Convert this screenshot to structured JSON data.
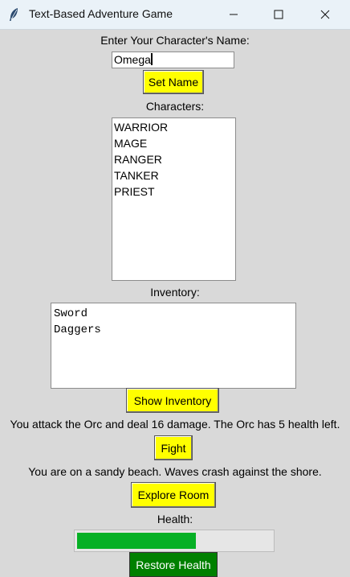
{
  "window": {
    "title": "Text-Based Adventure Game",
    "controls": [
      "minimize-icon",
      "maximize-icon",
      "close-icon"
    ]
  },
  "name_section": {
    "prompt": "Enter Your Character's Name:",
    "value": "Omega",
    "button": "Set Name"
  },
  "characters": {
    "label": "Characters:",
    "items": [
      "WARRIOR",
      "MAGE",
      "RANGER",
      "TANKER",
      "PRIEST"
    ]
  },
  "inventory": {
    "label": "Inventory:",
    "lines": [
      "Sword",
      "Daggers"
    ],
    "button": "Show Inventory"
  },
  "combat": {
    "message": "You attack the Orc and deal 16 damage. The Orc has 5 health left.",
    "button": "Fight"
  },
  "exploration": {
    "message": "You are on a sandy beach. Waves crash against the shore.",
    "button": "Explore Room"
  },
  "health": {
    "label": "Health:",
    "fraction": 0.61,
    "bar_color": "#06b025",
    "button": "Restore Health",
    "button_color": "#008000"
  },
  "colors": {
    "background": "#d9d9d9",
    "button_yellow": "#ffff00"
  }
}
